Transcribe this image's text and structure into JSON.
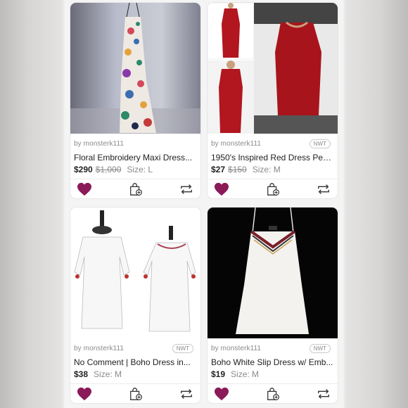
{
  "listings": [
    {
      "seller": "by monsterk111",
      "badge": "",
      "title": "Floral Embroidery Maxi Dress...",
      "price": "$290",
      "original_price": "$1,000",
      "size": "Size: L",
      "image": "floral-maxi-dress-photo"
    },
    {
      "seller": "by monsterk111",
      "badge": "NWT",
      "title": "1950's Inspired Red Dress Penc...",
      "price": "$27",
      "original_price": "$150",
      "size": "Size: M",
      "image": "red-pencil-dress-collage"
    },
    {
      "seller": "by monsterk111",
      "badge": "NWT",
      "title": "No Comment | Boho Dress in...",
      "price": "$38",
      "original_price": "",
      "size": "Size: M",
      "image": "white-off-shoulder-boho-dress-photo"
    },
    {
      "seller": "by monsterk111",
      "badge": "NWT",
      "title": "Boho White Slip Dress w/ Emb...",
      "price": "$19",
      "original_price": "",
      "size": "Size: M",
      "image": "white-slip-dress-photo"
    }
  ],
  "icons": {
    "like": "heart-icon",
    "bag": "add-to-bag-icon",
    "share": "share-icon"
  },
  "colors": {
    "like": "#8b1a58",
    "text": "#222222",
    "muted": "#8a8a8a"
  }
}
